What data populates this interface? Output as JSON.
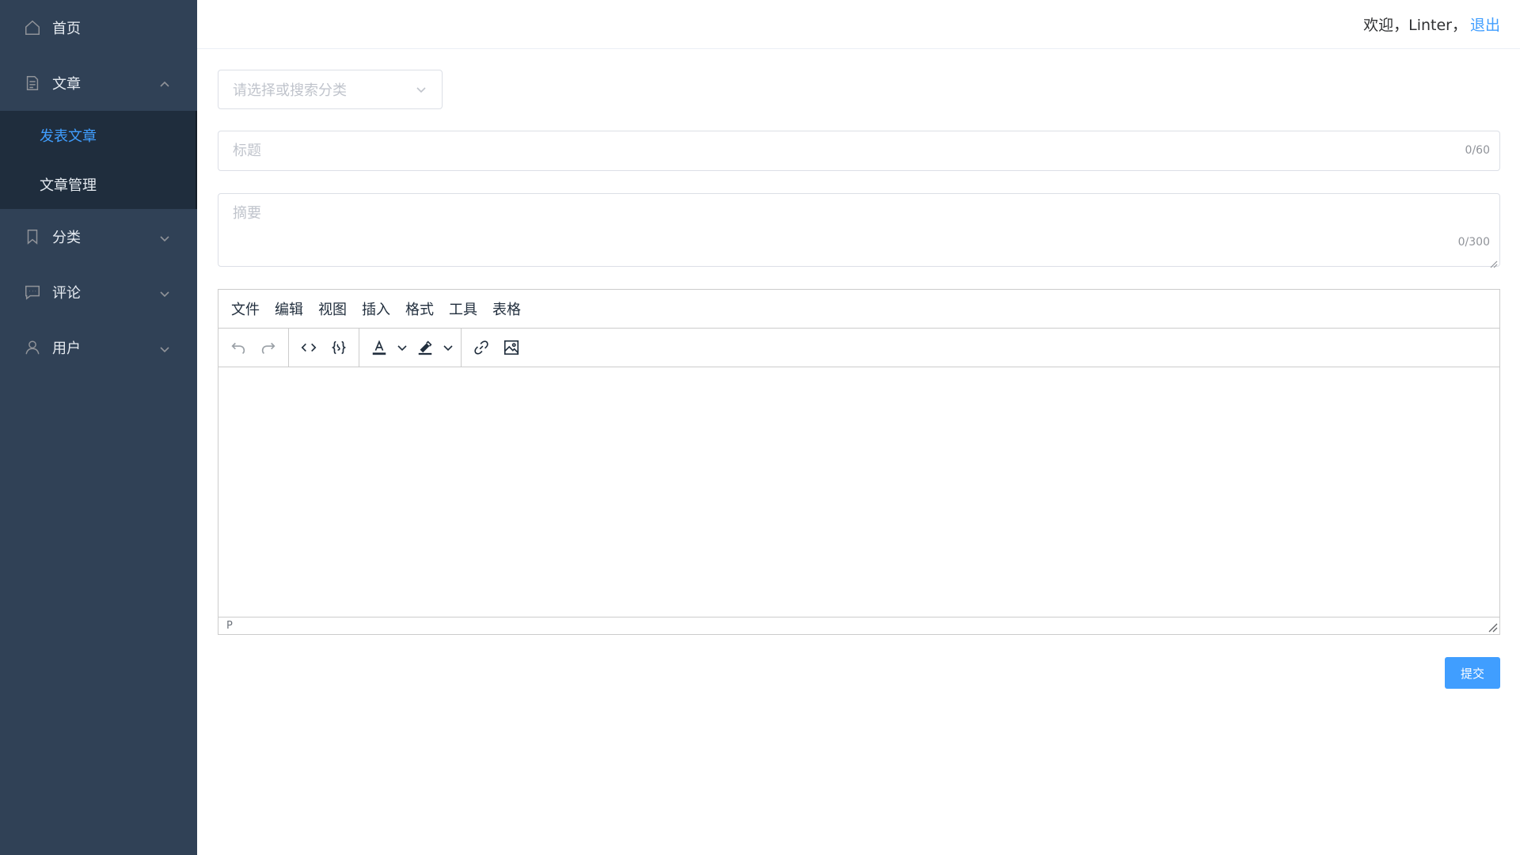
{
  "sidebar": {
    "items": [
      {
        "label": "首页",
        "icon": "home-icon"
      },
      {
        "label": "文章",
        "icon": "document-icon",
        "expanded": true,
        "children": [
          {
            "label": "发表文章",
            "active": true
          },
          {
            "label": "文章管理",
            "active": false
          }
        ]
      },
      {
        "label": "分类",
        "icon": "bookmark-icon"
      },
      {
        "label": "评论",
        "icon": "comment-icon"
      },
      {
        "label": "用户",
        "icon": "user-icon"
      }
    ]
  },
  "header": {
    "welcome": "欢迎，Linter，",
    "logout": "退出"
  },
  "form": {
    "category_placeholder": "请选择或搜索分类",
    "title_placeholder": "标题",
    "title_value": "",
    "title_counter": "0/60",
    "summary_placeholder": "摘要",
    "summary_value": "",
    "summary_counter": "0/300",
    "submit_label": "提交"
  },
  "editor": {
    "menubar": [
      "文件",
      "编辑",
      "视图",
      "插入",
      "格式",
      "工具",
      "表格"
    ],
    "toolbar_icons": [
      "undo-icon",
      "redo-icon",
      "source-code-icon",
      "code-sample-icon",
      "text-color-icon",
      "highlight-color-icon",
      "link-icon",
      "image-icon"
    ],
    "status_path": "P"
  },
  "colors": {
    "sidebar_bg": "#304156",
    "submenu_bg": "#1f2d3d",
    "accent": "#409eff",
    "border": "#dcdfe6"
  }
}
